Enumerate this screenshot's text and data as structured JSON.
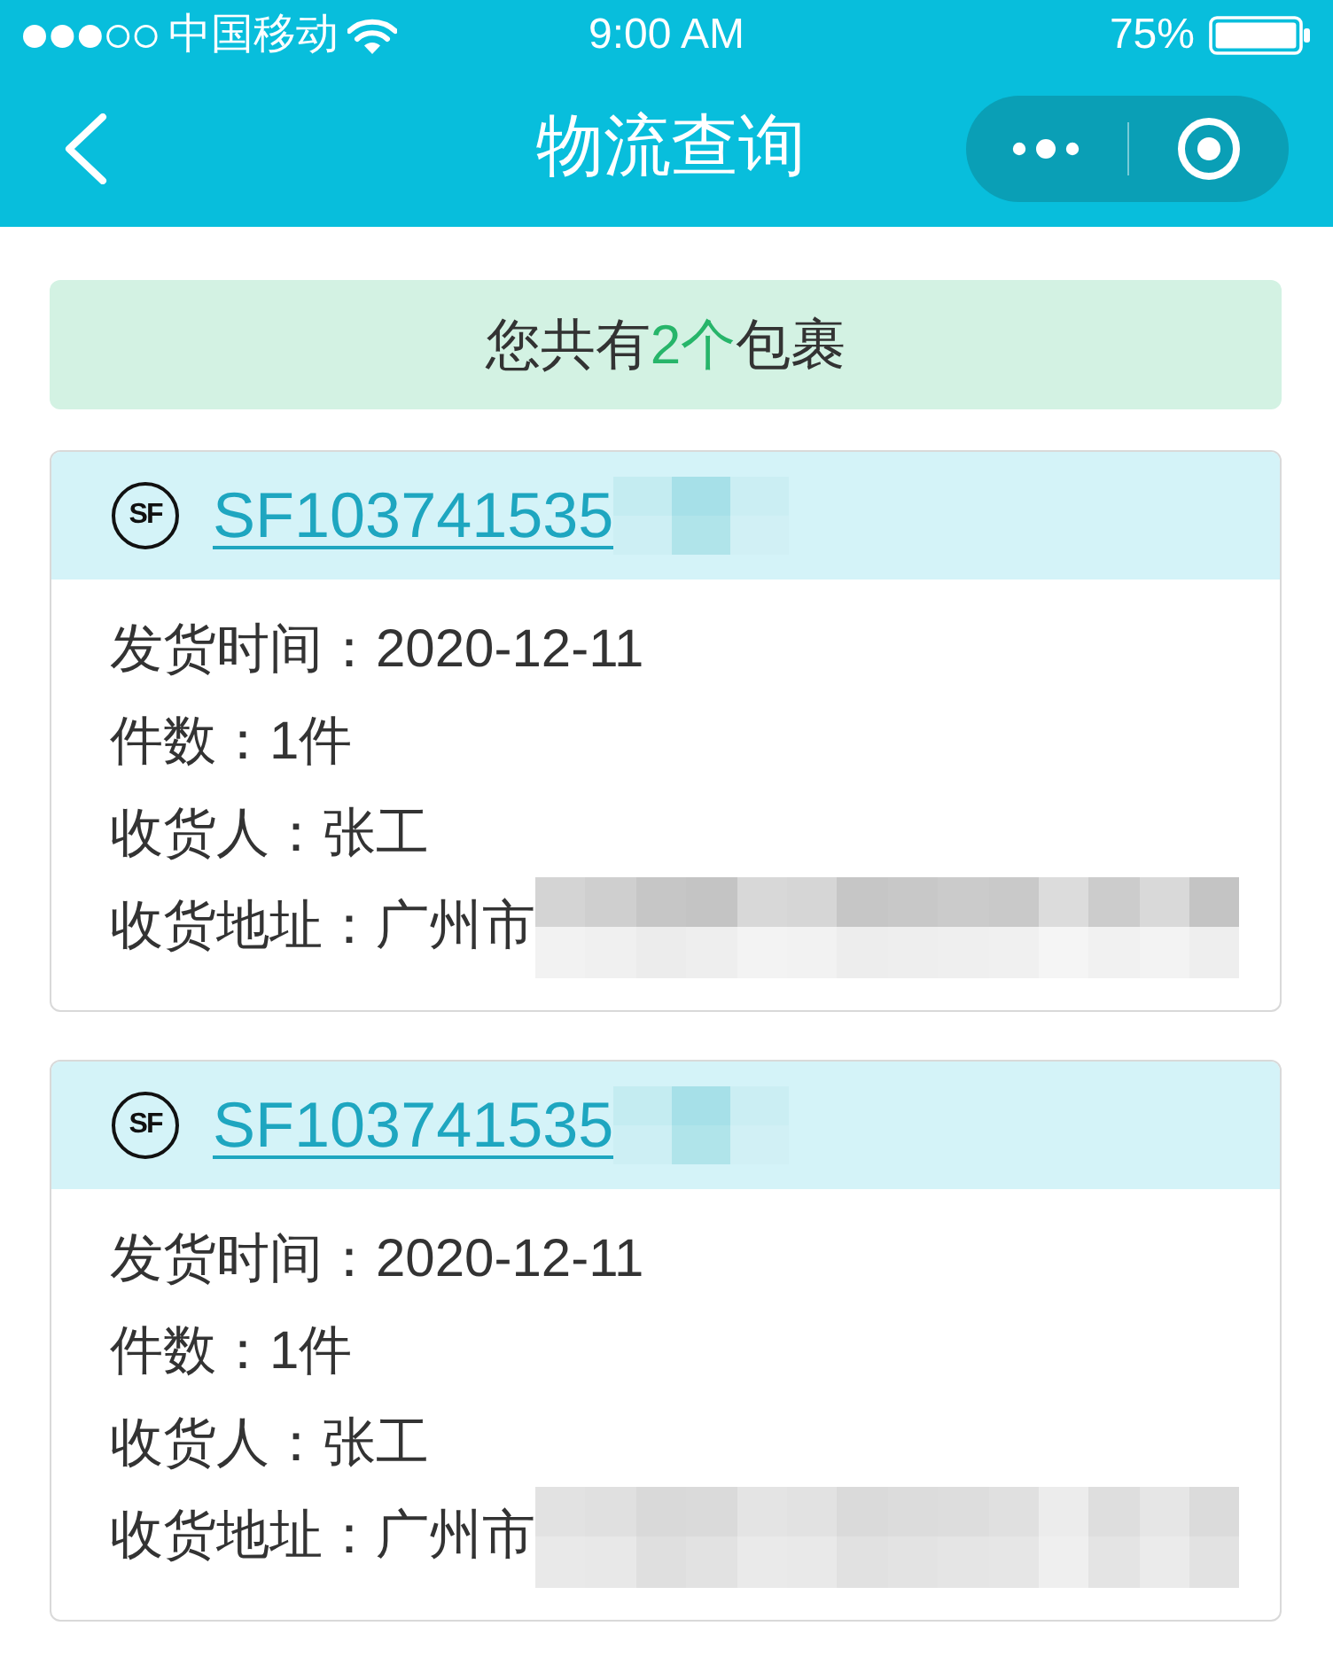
{
  "status_bar": {
    "carrier": "中国移动",
    "time": "9:00 AM",
    "battery": "75%"
  },
  "nav_bar": {
    "title": "物流查询"
  },
  "summary": {
    "prefix": "您共有",
    "count": "2个",
    "suffix": "包裹"
  },
  "packages": [
    {
      "logo": "SF",
      "tracking_number": "SF103741535",
      "tracking_masked": true,
      "fields": [
        {
          "label": "发货时间：",
          "value": "2020-12-11",
          "masked": false
        },
        {
          "label": "件数：",
          "value": "1件",
          "masked": false
        },
        {
          "label": "收货人：",
          "value": "张工",
          "masked": false
        },
        {
          "label": "收货地址：",
          "value": "广州市",
          "masked": true
        }
      ]
    },
    {
      "logo": "SF",
      "tracking_number": "SF103741535",
      "tracking_masked": true,
      "fields": [
        {
          "label": "发货时间：",
          "value": "2020-12-11",
          "masked": false
        },
        {
          "label": "件数：",
          "value": "1件",
          "masked": false
        },
        {
          "label": "收货人：",
          "value": "张工",
          "masked": false
        },
        {
          "label": "收货地址：",
          "value": "广州市",
          "masked": true
        }
      ]
    }
  ]
}
